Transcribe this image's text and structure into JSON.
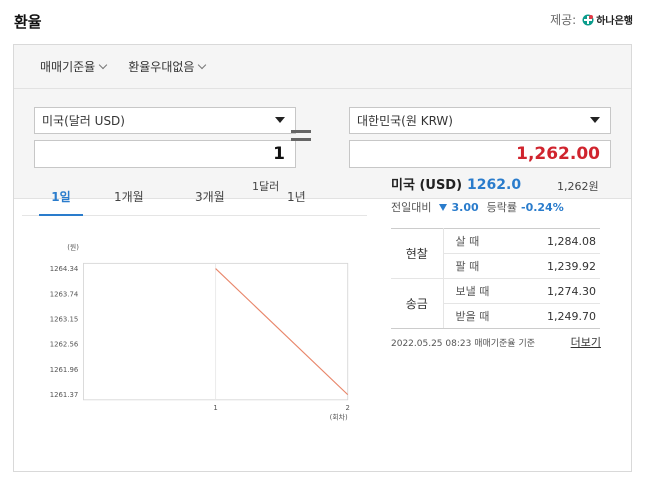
{
  "header": {
    "title": "환율",
    "provider_label": "제공:",
    "provider_name": "하나은행"
  },
  "filters": [
    "매매기준율",
    "환율우대없음"
  ],
  "converter": {
    "from_currency": "미국(달러 USD)",
    "from_amount": "1",
    "from_hint": "1달러",
    "to_currency": "대한민국(원 KRW)",
    "to_amount": "1,262.00",
    "to_hint": "1,262원"
  },
  "tabs": [
    "1일",
    "1개월",
    "3개월",
    "1년"
  ],
  "chart_data": {
    "type": "line",
    "ylabel": "(원)",
    "xlabel": "(회차)",
    "x": [
      1,
      2
    ],
    "values": [
      1264.34,
      1261.37
    ],
    "y_ticks": [
      "1264.34",
      "1263.74",
      "1263.15",
      "1262.56",
      "1261.96",
      "1261.37"
    ],
    "x_ticks": [
      "1",
      "2"
    ],
    "ylim": [
      1261.37,
      1264.34
    ],
    "xlim": [
      0,
      2
    ],
    "color": "#e8866a",
    "grid": false
  },
  "info": {
    "country": "미국 (USD)",
    "rate": "1262.0",
    "change_label": "전일대비",
    "change_value": "3.00",
    "ratio_label": "등락률",
    "ratio_value": "-0.24%"
  },
  "table": {
    "cash_label": "현찰",
    "cash_buy_label": "살 때",
    "cash_buy": "1,284.08",
    "cash_sell_label": "팔 때",
    "cash_sell": "1,239.92",
    "wire_label": "송금",
    "wire_send_label": "보낼 때",
    "wire_send": "1,274.30",
    "wire_receive_label": "받을 때",
    "wire_receive": "1,249.70"
  },
  "footer": {
    "timestamp": "2022.05.25 08:23 매매기준율 기준",
    "more": "더보기"
  },
  "colors": {
    "accent": "#2a7ccc",
    "price_red": "#d0242e",
    "chart_line": "#e8866a"
  }
}
